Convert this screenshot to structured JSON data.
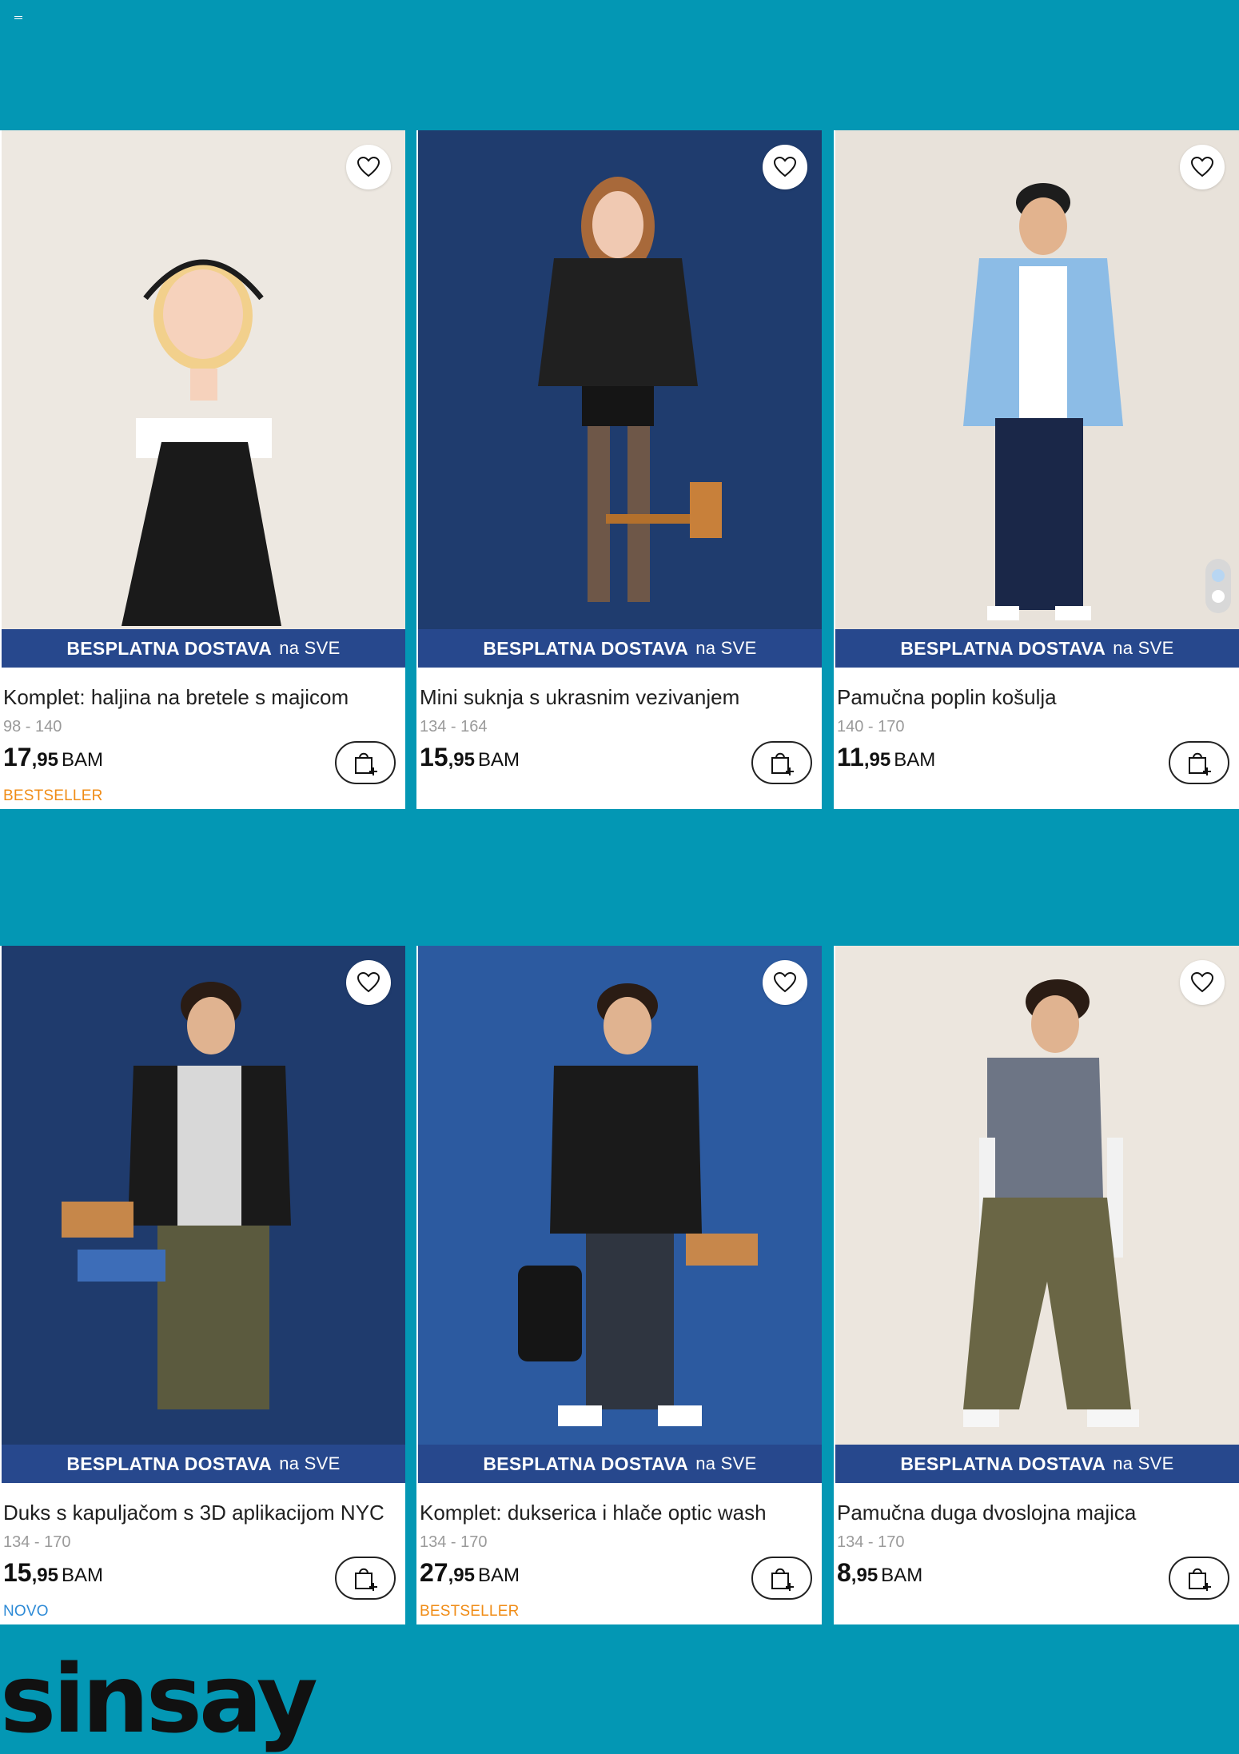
{
  "banner": {
    "bold": "BESPLATNA DOSTAVA",
    "rest": "na SVE"
  },
  "brand": "sinsay",
  "products": [
    {
      "name": "Komplet: haljina na bretele s majicom",
      "sizes": "98 - 140",
      "price_int": "17",
      "price_dec": ",95",
      "currency": "BAM",
      "tag": "BESTSELLER",
      "tag_type": "bestseller"
    },
    {
      "name": "Mini suknja s ukrasnim vezivanjem",
      "sizes": "134 - 164",
      "price_int": "15",
      "price_dec": ",95",
      "currency": "BAM",
      "tag": "",
      "tag_type": ""
    },
    {
      "name": "Pamučna poplin košulja",
      "sizes": "140 - 170",
      "price_int": "11",
      "price_dec": ",95",
      "currency": "BAM",
      "tag": "",
      "tag_type": ""
    },
    {
      "name": "Duks s kapuljačom s 3D aplikacijom NYC",
      "sizes": "134 - 170",
      "price_int": "15",
      "price_dec": ",95",
      "currency": "BAM",
      "tag": "NOVO",
      "tag_type": "new"
    },
    {
      "name": "Komplet: dukserica i hlače optic wash",
      "sizes": "134 - 170",
      "price_int": "27",
      "price_dec": ",95",
      "currency": "BAM",
      "tag": "BESTSELLER",
      "tag_type": "bestseller"
    },
    {
      "name": "Pamučna duga dvoslojna majica",
      "sizes": "134 - 170",
      "price_int": "8",
      "price_dec": ",95",
      "currency": "BAM",
      "tag": "",
      "tag_type": ""
    }
  ],
  "colors": {
    "page_bg": "#0397b4",
    "banner_bg": "#27488d",
    "bestseller": "#f08c16",
    "new": "#2d8ad6"
  }
}
